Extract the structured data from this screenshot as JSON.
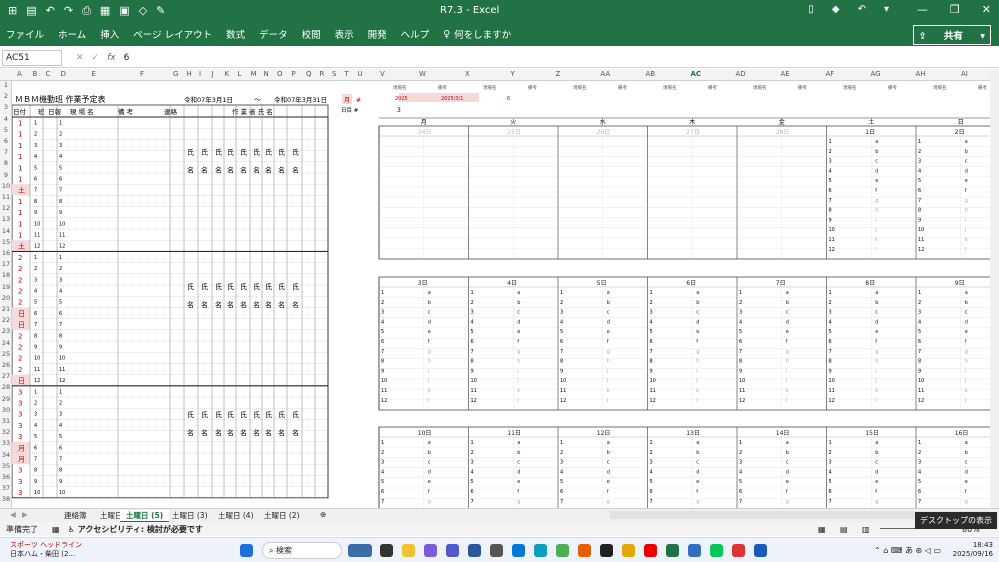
{
  "window": {
    "title": "R7.3  -  Excel",
    "share_label": "共有",
    "search_help": "何をしますか"
  },
  "ribbon_tabs": [
    "ファイル",
    "ホーム",
    "挿入",
    "ページ レイアウト",
    "数式",
    "データ",
    "校閲",
    "表示",
    "開発",
    "ヘルプ"
  ],
  "formula_bar": {
    "name_box": "AC51",
    "fx": "fx",
    "value": "6"
  },
  "columns": [
    "A",
    "B",
    "C",
    "D",
    "E",
    "F",
    "G",
    "H",
    "I",
    "J",
    "K",
    "L",
    "M",
    "N",
    "O",
    "P",
    "Q",
    "R",
    "S",
    "T",
    "U",
    "V",
    "W",
    "X",
    "Y",
    "Z",
    "AA",
    "AB",
    "AC",
    "AD",
    "AE",
    "AF",
    "AG",
    "AH",
    "AI"
  ],
  "schedule": {
    "title": "ＭＢＭ機動班  作業予定表",
    "period_start": "令和07年3月1日",
    "tilde": "〜",
    "period_end": "令和07年3月31日",
    "headers": [
      "日付",
      "班",
      "日報",
      "現  場  名",
      "備        考",
      "連絡",
      "作  業  者  氏  名"
    ],
    "name_top": "氏",
    "name_bottom": "名",
    "day_groups": [
      {
        "day": "1",
        "rows": [
          [
            "1",
            "1",
            "1"
          ],
          [
            "1",
            "2",
            "2"
          ],
          [
            "1",
            "3",
            "3"
          ],
          [
            "1",
            "4",
            "4"
          ],
          [
            "1",
            "5",
            "5"
          ],
          [
            "1",
            "6",
            "6"
          ],
          [
            "土",
            "7",
            "7"
          ],
          [
            "1",
            "8",
            "8"
          ],
          [
            "1",
            "9",
            "9"
          ],
          [
            "1",
            "10",
            "10"
          ],
          [
            "1",
            "11",
            "11"
          ],
          [
            "土",
            "12",
            "12"
          ]
        ]
      },
      {
        "day": "2",
        "rows": [
          [
            "2",
            "1",
            "1"
          ],
          [
            "2",
            "2",
            "2"
          ],
          [
            "2",
            "3",
            "3"
          ],
          [
            "2",
            "4",
            "4"
          ],
          [
            "2",
            "5",
            "5"
          ],
          [
            "日",
            "6",
            "6"
          ],
          [
            "日",
            "7",
            "7"
          ],
          [
            "2",
            "8",
            "8"
          ],
          [
            "2",
            "9",
            "9"
          ],
          [
            "2",
            "10",
            "10"
          ],
          [
            "2",
            "11",
            "11"
          ],
          [
            "日",
            "12",
            "12"
          ]
        ]
      },
      {
        "day": "3",
        "rows": [
          [
            "3",
            "1",
            "1"
          ],
          [
            "3",
            "2",
            "2"
          ],
          [
            "3",
            "3",
            "3"
          ],
          [
            "3",
            "4",
            "4"
          ],
          [
            "3",
            "5",
            "5"
          ],
          [
            "月",
            "6",
            "6"
          ],
          [
            "月",
            "7",
            "7"
          ],
          [
            "3",
            "8",
            "8"
          ],
          [
            "3",
            "9",
            "9"
          ],
          [
            "3",
            "10",
            "10"
          ]
        ]
      }
    ]
  },
  "side_labels": {
    "q_label": "月",
    "r_label": "#",
    "note": "日目 #"
  },
  "calendar": {
    "header_labels": [
      "現場名",
      "備考",
      "現場名",
      "備考",
      "現場名",
      "備考",
      "現場名",
      "備考",
      "現場名",
      "備考",
      "現場名",
      "備考",
      "現場名",
      "備考"
    ],
    "year": "2025",
    "date": "2025/3/1",
    "num": "6",
    "row3": "3",
    "weekdays": [
      "月",
      "火",
      "水",
      "木",
      "金",
      "土",
      "日"
    ],
    "week1": [
      "24日",
      "25日",
      "26日",
      "27日",
      "28日",
      "1日",
      "2日"
    ],
    "week2": [
      "3日",
      "4日",
      "5日",
      "6日",
      "7日",
      "8日",
      "9日"
    ],
    "week3": [
      "10日",
      "11日",
      "12日",
      "13日",
      "14日",
      "15日",
      "16日"
    ],
    "slot_nums": [
      "1",
      "2",
      "3",
      "4",
      "5",
      "6",
      "7",
      "8",
      "9",
      "10",
      "11",
      "12"
    ],
    "slot_letters": [
      "a",
      "b",
      "c",
      "d",
      "e",
      "f",
      "g",
      "h",
      "i",
      "j",
      "k",
      "l"
    ]
  },
  "row_numbers": [
    "1",
    "2",
    "3",
    "4",
    "5",
    "6",
    "7",
    "8",
    "9",
    "10",
    "11",
    "12",
    "13",
    "14",
    "15",
    "16",
    "17",
    "18",
    "19",
    "20",
    "21",
    "22",
    "23",
    "24",
    "25",
    "26",
    "27",
    "28",
    "29",
    "30",
    "31",
    "32",
    "33",
    "34",
    "35",
    "36",
    "37",
    "38"
  ],
  "sheet_tabs": [
    "連絡簿",
    "土曜日",
    "土曜日 (5)",
    "土曜日 (3)",
    "土曜日 (4)",
    "土曜日 (2)"
  ],
  "active_tab": "土曜日 (5)",
  "status": {
    "ready": "準備完了",
    "accessibility": "アクセシビリティ: 検討が必要です",
    "zoom": "80%"
  },
  "tooltip": "デスクトップの表示",
  "taskbar": {
    "search": "検索",
    "news_title": "スポーツ ヘッドライン",
    "news_sub": "日本ハム・柴田 (2...",
    "time": "18:43",
    "date": "2025/09/16",
    "ime": "あ"
  },
  "colors": {
    "excel_green": "#217346",
    "red": "#cc0000",
    "pink_cell": "#f6d9d9"
  }
}
